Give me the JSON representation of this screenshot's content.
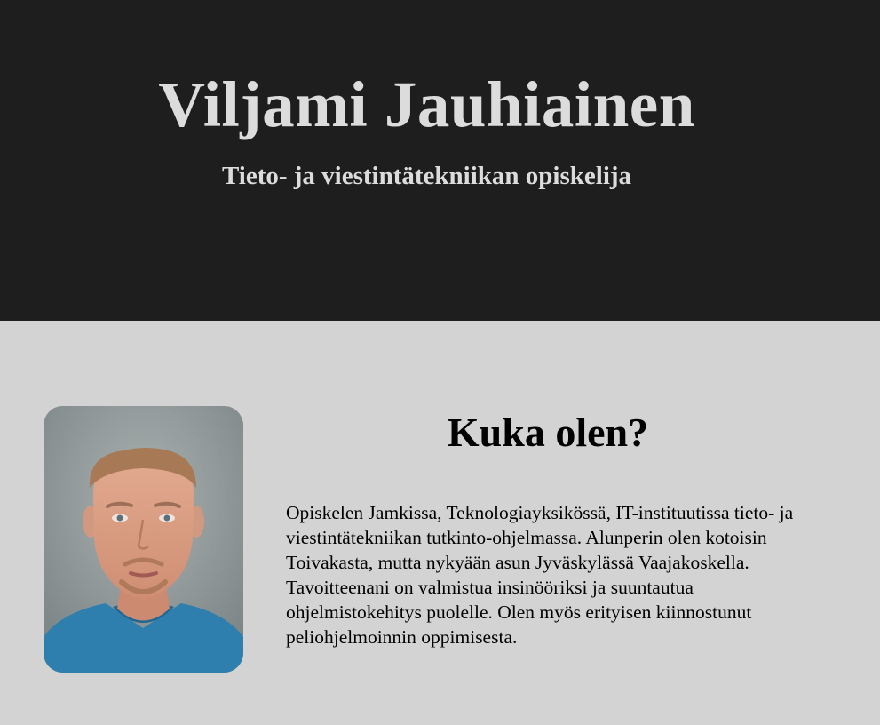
{
  "header": {
    "name": "Viljami Jauhiainen",
    "subtitle": "Tieto- ja viestintätekniikan opiskelija"
  },
  "about": {
    "heading": "Kuka olen?",
    "text": "Opiskelen Jamkissa, Teknologiayksikössä, IT-instituutissa tieto- ja viestintätekniikan tutkinto-ohjelmassa. Alunperin olen kotoisin Toivakasta, mutta nykyään asun Jyväskylässä Vaajakoskella. Tavoitteenani on valmistua insinööriksi ja suuntautua ohjelmistokehitys puolelle. Olen myös erityisen kiinnostunut peliohjelmoinnin oppimisesta.",
    "photo_icon": "portrait-photo"
  },
  "colors": {
    "header_bg": "#1e1e1e",
    "header_text": "#dcdcdc",
    "content_bg": "#d3d3d3",
    "content_text": "#000000"
  }
}
